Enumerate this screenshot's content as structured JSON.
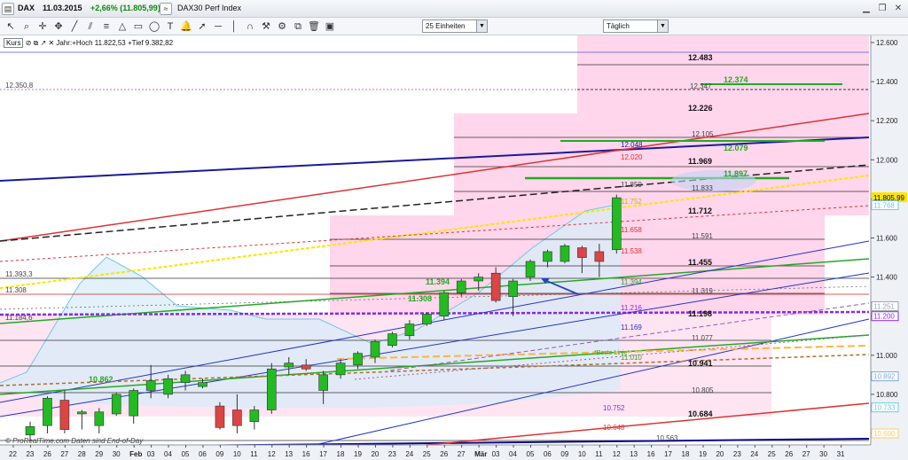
{
  "title_bar": {
    "instrument": "DAX",
    "date": "11.03.2015",
    "change": "+2,66% (11.805,99)",
    "index_name": "DAX30 Perf Index"
  },
  "toolbar": {
    "units_select": "25 Einheiten",
    "interval_select": "Täglich"
  },
  "legend": {
    "kurs_label": "Kurs",
    "year_high_low": "Jahr:+Hoch 11.822,53 +Tief 9.382,82"
  },
  "copyright": "© ProRealTime.com  Daten sind End-of-Day",
  "colors": {
    "accent": "#0000aa",
    "up": "#22bb22",
    "down": "#dd4444",
    "zone": "#ffd6ec"
  },
  "chart_data": {
    "type": "candlestick",
    "y_axis_labels": [
      "12.600",
      "12.400",
      "12.200",
      "12.000",
      "11.800",
      "11.600",
      "11.400",
      "11.200",
      "11.000",
      "10.800",
      "10.600"
    ],
    "current_price_label": "11.805,99",
    "right_axis_markers": [
      "11.768",
      "11.251",
      "11.200",
      "10.892",
      "10.733",
      "10.600"
    ],
    "x_axis_labels": [
      "22",
      "23",
      "26",
      "27",
      "28",
      "29",
      "30",
      "Feb",
      "03",
      "04",
      "05",
      "06",
      "09",
      "10",
      "11",
      "12",
      "13",
      "16",
      "17",
      "18",
      "19",
      "20",
      "23",
      "24",
      "25",
      "26",
      "27",
      "Mär",
      "03",
      "04",
      "05",
      "06",
      "09",
      "10",
      "11",
      "12",
      "13",
      "16",
      "17",
      "18",
      "19",
      "20",
      "23",
      "24",
      "25",
      "26",
      "27",
      "30",
      "31"
    ],
    "level_labels": [
      "12.483",
      "12.347",
      "12.374",
      "12.226",
      "12.105",
      "12.048",
      "12.079",
      "12.020",
      "11.969",
      "11.897",
      "11.850",
      "11.833",
      "11.752",
      "11.712",
      "11.658",
      "11.591",
      "11.538",
      "11.455",
      "11.394",
      "11.394",
      "11.319",
      "11.308",
      "11.216",
      "11.198",
      "11.169",
      "11.077",
      "11.010",
      "10.941",
      "10.862",
      "10.805",
      "10.752",
      "10.684",
      "10.648",
      "10.563",
      "12.350,8",
      "11.393,3",
      "11.308",
      "11.184,6",
      "*Beste Linie*"
    ],
    "candles": [
      {
        "date": "22",
        "open": 10592,
        "high": 10660,
        "low": 10560,
        "close": 10635
      },
      {
        "date": "23",
        "open": 10640,
        "high": 10790,
        "low": 10600,
        "close": 10780
      },
      {
        "date": "26",
        "open": 10770,
        "high": 10820,
        "low": 10600,
        "close": 10620
      },
      {
        "date": "27",
        "open": 10700,
        "high": 10720,
        "low": 10620,
        "close": 10710
      },
      {
        "date": "28",
        "open": 10640,
        "high": 10730,
        "low": 10600,
        "close": 10710
      },
      {
        "date": "29",
        "open": 10700,
        "high": 10810,
        "low": 10690,
        "close": 10800
      },
      {
        "date": "30",
        "open": 10690,
        "high": 10830,
        "low": 10650,
        "close": 10820
      },
      {
        "date": "Feb",
        "open": 10820,
        "high": 10950,
        "low": 10780,
        "close": 10870
      },
      {
        "date": "03",
        "open": 10800,
        "high": 10900,
        "low": 10780,
        "close": 10880
      },
      {
        "date": "04",
        "open": 10860,
        "high": 10920,
        "low": 10820,
        "close": 10900
      },
      {
        "date": "05",
        "open": 10840,
        "high": 10880,
        "low": 10830,
        "close": 10860
      },
      {
        "date": "06",
        "open": 10740,
        "high": 10760,
        "low": 10620,
        "close": 10630
      },
      {
        "date": "09",
        "open": 10720,
        "high": 10800,
        "low": 10600,
        "close": 10640
      },
      {
        "date": "10",
        "open": 10660,
        "high": 10740,
        "low": 10620,
        "close": 10720
      },
      {
        "date": "11",
        "open": 10720,
        "high": 10960,
        "low": 10700,
        "close": 10930
      },
      {
        "date": "12",
        "open": 10940,
        "high": 10990,
        "low": 10900,
        "close": 10960
      },
      {
        "date": "13",
        "open": 10950,
        "high": 10980,
        "low": 10920,
        "close": 10930
      },
      {
        "date": "16",
        "open": 10820,
        "high": 10920,
        "low": 10750,
        "close": 10900
      },
      {
        "date": "17",
        "open": 10900,
        "high": 10980,
        "low": 10880,
        "close": 10960
      },
      {
        "date": "18",
        "open": 10950,
        "high": 11020,
        "low": 10930,
        "close": 11010
      },
      {
        "date": "19",
        "open": 10990,
        "high": 11080,
        "low": 10960,
        "close": 11070
      },
      {
        "date": "20",
        "open": 11050,
        "high": 11120,
        "low": 11040,
        "close": 11110
      },
      {
        "date": "23",
        "open": 11100,
        "high": 11180,
        "low": 11080,
        "close": 11160
      },
      {
        "date": "24",
        "open": 11160,
        "high": 11220,
        "low": 11150,
        "close": 11210
      },
      {
        "date": "25",
        "open": 11200,
        "high": 11330,
        "low": 11180,
        "close": 11320
      },
      {
        "date": "26",
        "open": 11320,
        "high": 11390,
        "low": 11300,
        "close": 11380
      },
      {
        "date": "27",
        "open": 11380,
        "high": 11420,
        "low": 11330,
        "close": 11400
      },
      {
        "date": "Mär",
        "open": 11420,
        "high": 11450,
        "low": 11270,
        "close": 11280
      },
      {
        "date": "03",
        "open": 11300,
        "high": 11390,
        "low": 11200,
        "close": 11380
      },
      {
        "date": "04",
        "open": 11400,
        "high": 11490,
        "low": 11380,
        "close": 11480
      },
      {
        "date": "05",
        "open": 11480,
        "high": 11540,
        "low": 11450,
        "close": 11530
      },
      {
        "date": "06",
        "open": 11480,
        "high": 11570,
        "low": 11470,
        "close": 11560
      },
      {
        "date": "09",
        "open": 11550,
        "high": 11560,
        "low": 11420,
        "close": 11500
      },
      {
        "date": "10",
        "open": 11530,
        "high": 11570,
        "low": 11400,
        "close": 11480
      },
      {
        "date": "11",
        "open": 11540,
        "high": 11822,
        "low": 11520,
        "close": 11806
      }
    ]
  }
}
